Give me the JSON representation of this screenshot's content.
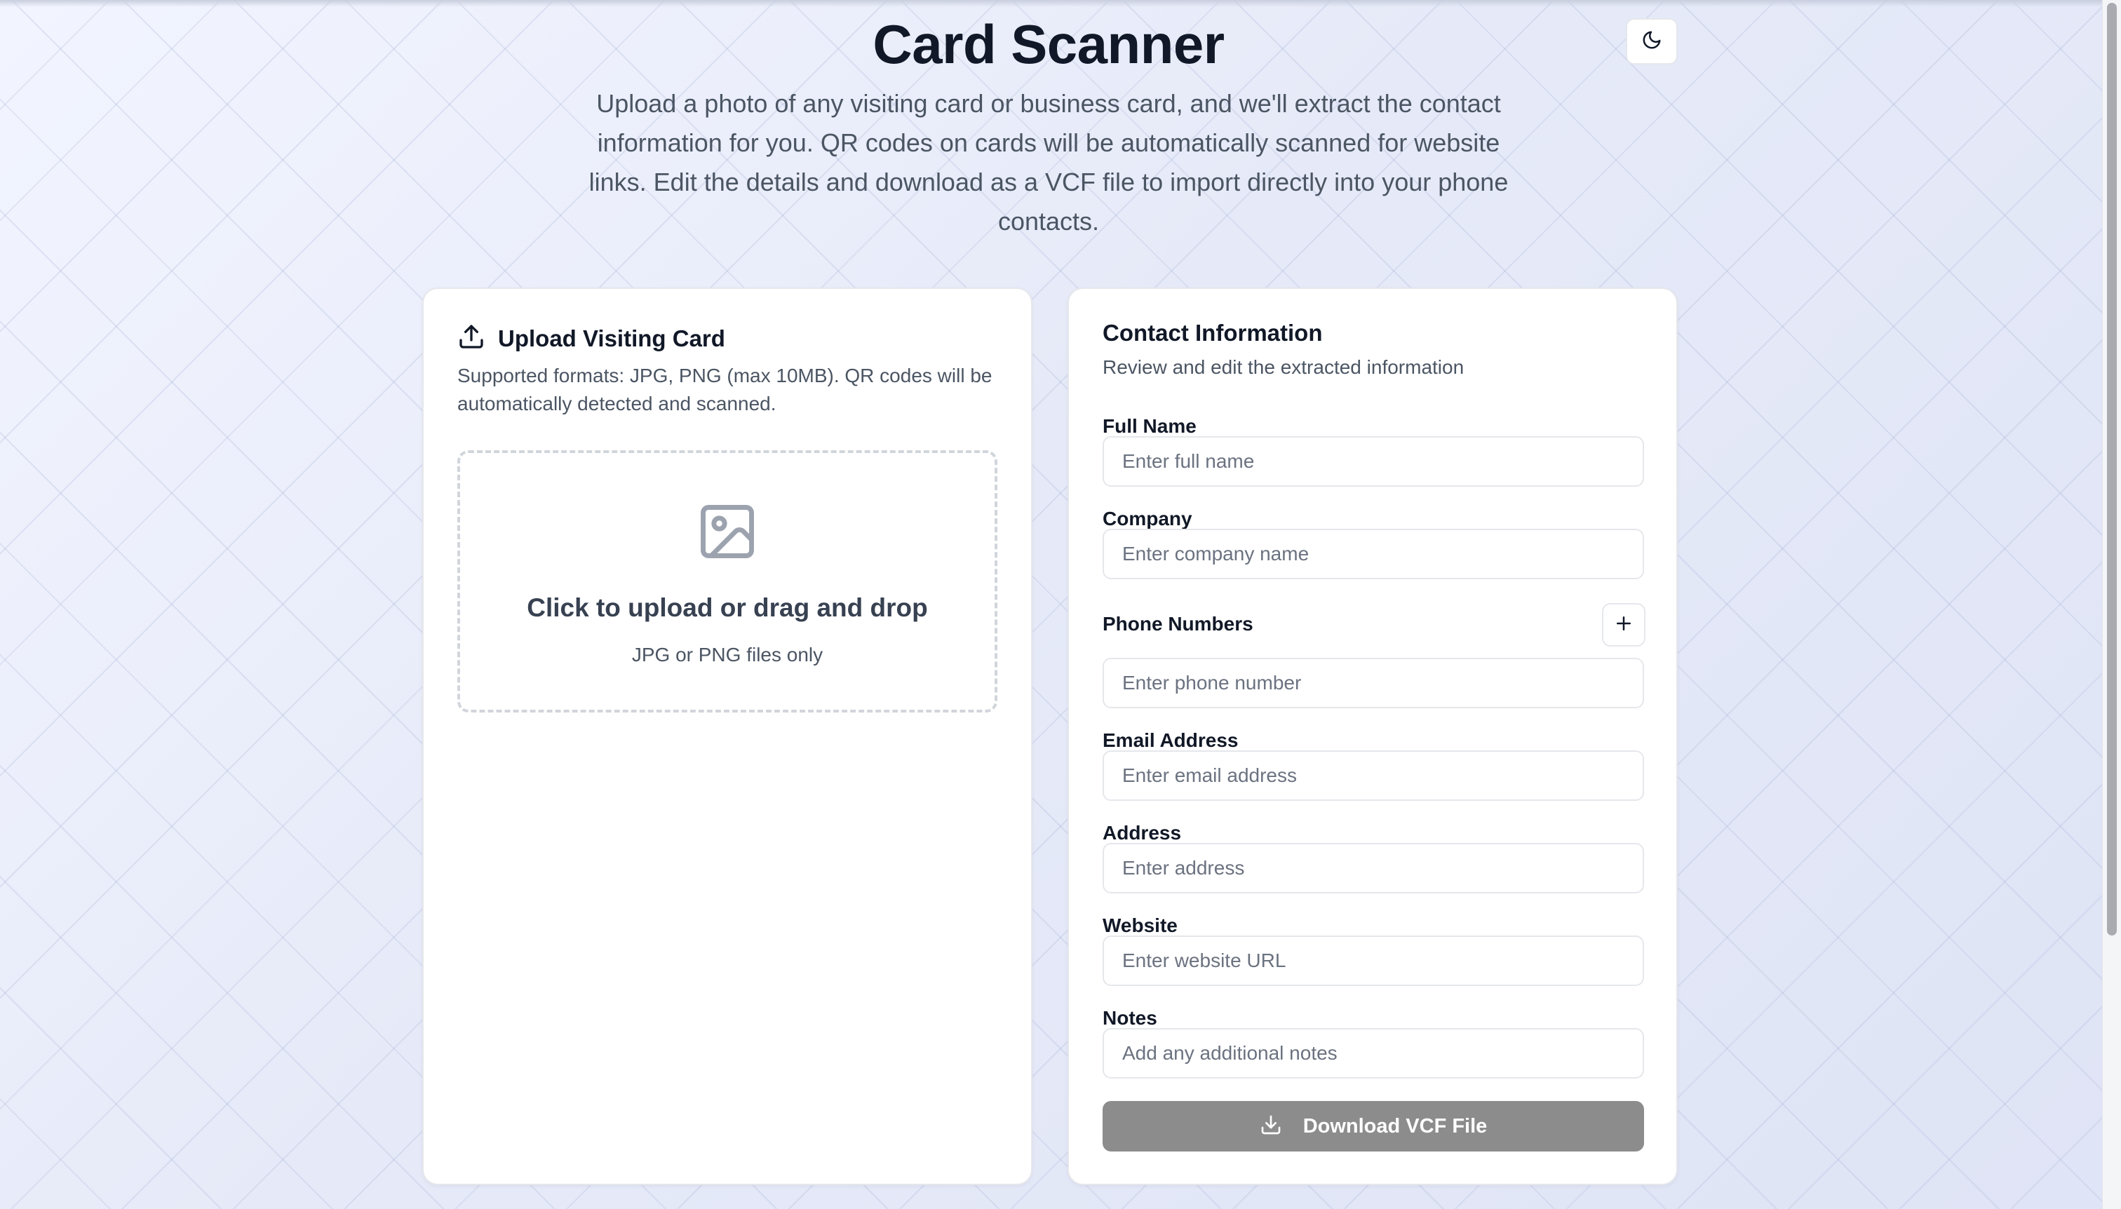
{
  "header": {
    "title": "Card Scanner",
    "subtitle": "Upload a photo of any visiting card or business card, and we'll extract the contact information for you. QR codes on cards will be automatically scanned for website links. Edit the details and download as a VCF file to import directly into your phone contacts.",
    "theme_toggle_icon": "moon-icon"
  },
  "upload": {
    "title": "Upload Visiting Card",
    "icon": "upload-icon",
    "description": "Supported formats: JPG, PNG (max 10MB). QR codes will be automatically detected and scanned.",
    "dropzone_icon": "image-icon",
    "dropzone_title": "Click to upload or drag and drop",
    "dropzone_hint": "JPG or PNG files only"
  },
  "contact": {
    "title": "Contact Information",
    "subtitle": "Review and edit the extracted information",
    "full_name": {
      "label": "Full Name",
      "placeholder": "Enter full name",
      "value": ""
    },
    "company": {
      "label": "Company",
      "placeholder": "Enter company name",
      "value": ""
    },
    "phones": {
      "label": "Phone Numbers",
      "add_icon": "plus-icon",
      "placeholder": "Enter phone number",
      "value": ""
    },
    "email": {
      "label": "Email Address",
      "placeholder": "Enter email address",
      "value": ""
    },
    "address": {
      "label": "Address",
      "placeholder": "Enter address",
      "value": ""
    },
    "website": {
      "label": "Website",
      "placeholder": "Enter website URL",
      "value": ""
    },
    "notes": {
      "label": "Notes",
      "placeholder": "Add any additional notes",
      "value": ""
    },
    "download_label": "Download VCF File",
    "download_icon": "download-icon"
  },
  "colors": {
    "download_button_bg": "#8c8c8c",
    "text_primary": "#111827",
    "text_muted": "#4b5563"
  }
}
